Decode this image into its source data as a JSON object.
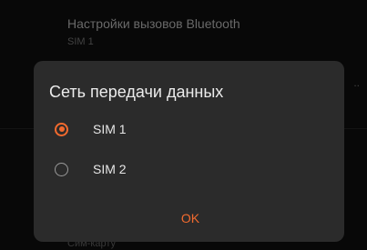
{
  "background": {
    "item_title": "Настройки вызовов Bluetooth",
    "item_subtitle": "SIM 1",
    "truncated_ellipsis": "..",
    "bottom_text": "Сим-карту"
  },
  "dialog": {
    "title": "Сеть передачи данных",
    "options": [
      {
        "label": "SIM 1",
        "selected": true
      },
      {
        "label": "SIM 2",
        "selected": false
      }
    ],
    "ok_label": "OK"
  },
  "colors": {
    "accent": "#f26a2e",
    "dialog_bg": "#2b2b2b",
    "page_bg": "#0b0b0b"
  }
}
